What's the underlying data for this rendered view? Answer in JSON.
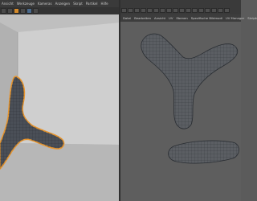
{
  "viewport_menu": [
    "Ansicht",
    "Werkzeuge",
    "Kameras",
    "Anzeigen",
    "Skript",
    "Partikel",
    "Hilfe"
  ],
  "uv_tabs": [
    "Datei",
    "Bearbeiten",
    "Ansicht",
    "UV",
    "Ebenen",
    "Spezifische Bildmodi",
    "UV Manager",
    "Skripte"
  ],
  "colors": {
    "accent": "#d48a2a",
    "viewport_bg": "#bdbdbd",
    "uv_bg": "#5e5e5e",
    "mesh_fill": "#4a4f57"
  }
}
